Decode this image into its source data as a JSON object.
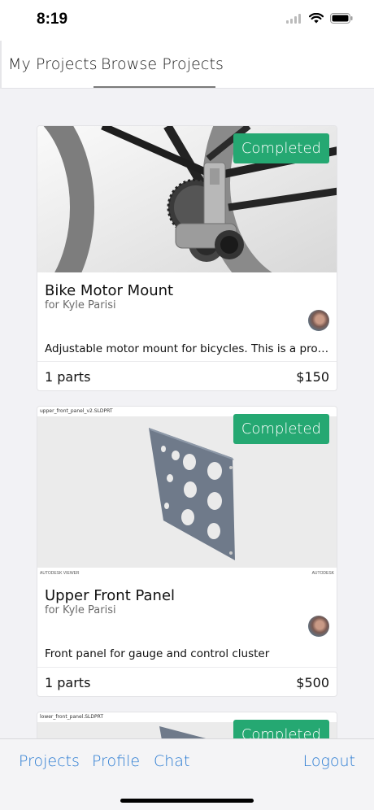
{
  "status_bar": {
    "time": "8:19"
  },
  "tabs": [
    {
      "label": "My Projects",
      "selected": false
    },
    {
      "label": "Browse Projects",
      "selected": true
    }
  ],
  "projects": [
    {
      "title": "Bike Motor Mount",
      "client": "for Kyle Parisi",
      "status": "Completed",
      "description": "Adjustable motor mount for bicycles. This is a proof o...",
      "parts": "1 parts",
      "price": "$150"
    },
    {
      "title": "Upper Front Panel",
      "client": "for Kyle Parisi",
      "status": "Completed",
      "description": "Front panel for gauge and control cluster",
      "parts": "1 parts",
      "price": "$500",
      "file_label": "upper_front_panel_v2.SLDPRT",
      "viewer_brand_left": "AUTODESK VIEWER",
      "viewer_brand_right": "AUTODESK"
    },
    {
      "status": "Completed",
      "file_label": "lower_front_panel.SLDPRT"
    }
  ],
  "bottom_nav": {
    "projects": "Projects",
    "profile": "Profile",
    "chat": "Chat",
    "logout": "Logout"
  },
  "colors": {
    "accent_blue": "#2a7bd2",
    "badge_green": "#25a872"
  }
}
